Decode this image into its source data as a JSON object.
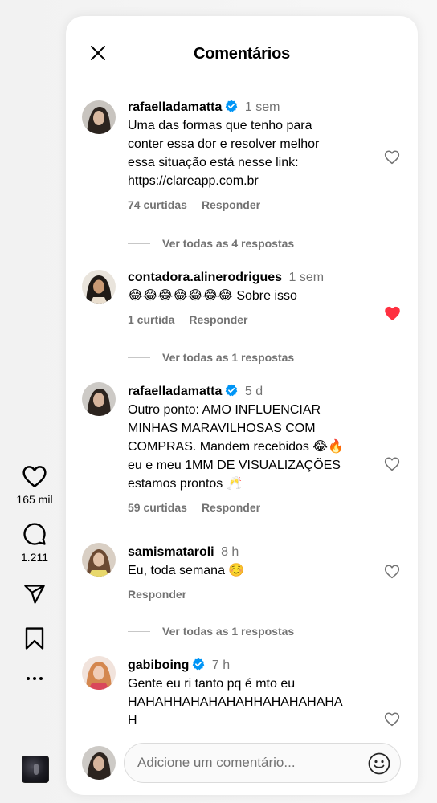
{
  "rail": {
    "like_count": "165 mil",
    "comment_count": "1.211"
  },
  "panel": {
    "title": "Comentários"
  },
  "comments": [
    {
      "username": "rafaelladamatta",
      "verified": true,
      "time": "1 sem",
      "lines": [
        "Uma das formas que tenho para",
        "conter essa dor e resolver melhor",
        "essa situação está nesse link:",
        "https://clareapp.com.br"
      ],
      "likes": "74 curtidas",
      "reply_label": "Responder",
      "liked": false,
      "replies_label": "Ver todas as 4 respostas"
    },
    {
      "username": "contadora.alinerodrigues",
      "verified": false,
      "time": "1 sem",
      "lines": [
        "😂😂😂😂😂😂😂 Sobre isso"
      ],
      "likes": "1 curtida",
      "reply_label": "Responder",
      "liked": true,
      "replies_label": "Ver todas as 1 respostas"
    },
    {
      "username": "rafaelladamatta",
      "verified": true,
      "time": "5 d",
      "lines": [
        "Outro ponto: AMO INFLUENCIAR",
        "MINHAS MARAVILHOSAS COM",
        "COMPRAS. Mandem recebidos 😂🔥",
        "eu e meu 1MM DE VISUALIZAÇÕES",
        "estamos prontos 🥂"
      ],
      "likes": "59 curtidas",
      "reply_label": "Responder",
      "liked": false,
      "replies_label": ""
    },
    {
      "username": "samismataroli",
      "verified": false,
      "time": "8 h",
      "lines": [
        "Eu, toda semana ☺️"
      ],
      "likes": "",
      "reply_label": "Responder",
      "liked": false,
      "replies_label": "Ver todas as 1 respostas"
    },
    {
      "username": "gabiboing",
      "verified": true,
      "time": "7 h",
      "lines": [
        "Gente eu ri tanto pq é mto eu",
        "HAHAHHAHAHAHAHHAHAHAHAHA",
        "H"
      ],
      "likes": "",
      "reply_label": "",
      "liked": false,
      "replies_label": ""
    }
  ],
  "composer": {
    "placeholder": "Adicione um comentário..."
  },
  "colors": {
    "verified_blue": "#0095f6",
    "like_red": "#ff3040",
    "muted_text": "#737373"
  },
  "icons": {
    "close": "close-icon",
    "heart": "heart-icon",
    "comment": "comment-icon",
    "share": "paper-plane-icon",
    "save": "bookmark-icon",
    "more": "more-icon",
    "emoji": "smiley-icon"
  }
}
